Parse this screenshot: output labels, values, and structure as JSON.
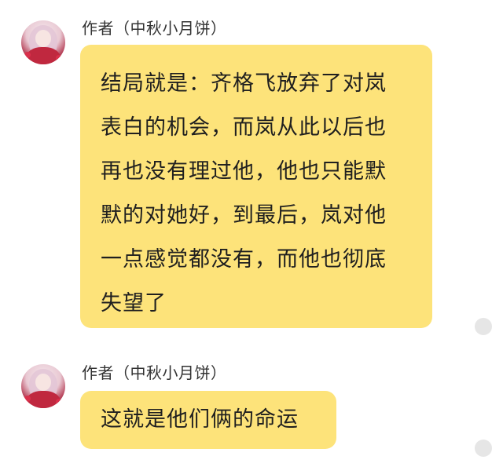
{
  "messages": [
    {
      "sender": "作者（中秋小月饼）",
      "avatar": "anime-girl-avatar",
      "lines": [
        "结局就是：齐格飞放弃了对岚",
        "表白的机会，而岚从此以后也",
        "再也没有理过他，他也只能默",
        "默的对她好，到最后，岚对他",
        "一点感觉都没有，而他也彻底",
        "失望了"
      ]
    },
    {
      "sender": "作者（中秋小月饼）",
      "avatar": "anime-girl-avatar",
      "lines": [
        "这就是他们俩的命运"
      ]
    }
  ],
  "colors": {
    "bubble": "#fde37a",
    "sender_text": "#333333",
    "message_text": "#1f1f1f",
    "status_dot": "#e6e6e6"
  }
}
